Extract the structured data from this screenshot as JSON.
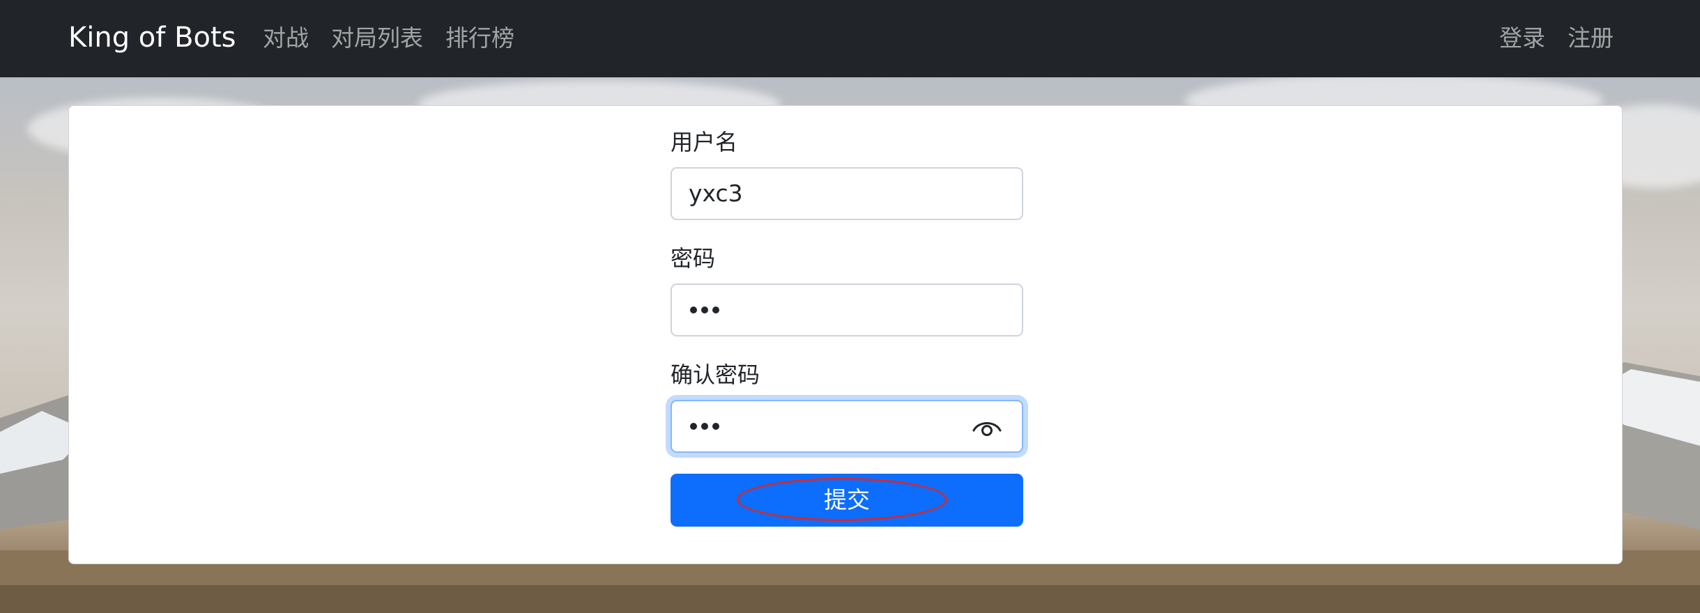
{
  "navbar": {
    "brand": "King of Bots",
    "left_links": [
      {
        "label": "对战"
      },
      {
        "label": "对局列表"
      },
      {
        "label": "排行榜"
      }
    ],
    "right_links": [
      {
        "label": "登录"
      },
      {
        "label": "注册"
      }
    ]
  },
  "form": {
    "username_label": "用户名",
    "username_value": "yxc3",
    "password_label": "密码",
    "password_masked_length": 3,
    "confirm_label": "确认密码",
    "confirm_masked_length": 3,
    "submit_label": "提交"
  },
  "icons": {
    "reveal_password": "eye-icon"
  },
  "colors": {
    "navbar_bg": "#212529",
    "primary": "#0d6efd",
    "focus_border": "#86b7fe",
    "annotation_ring": "#d12a2f"
  }
}
